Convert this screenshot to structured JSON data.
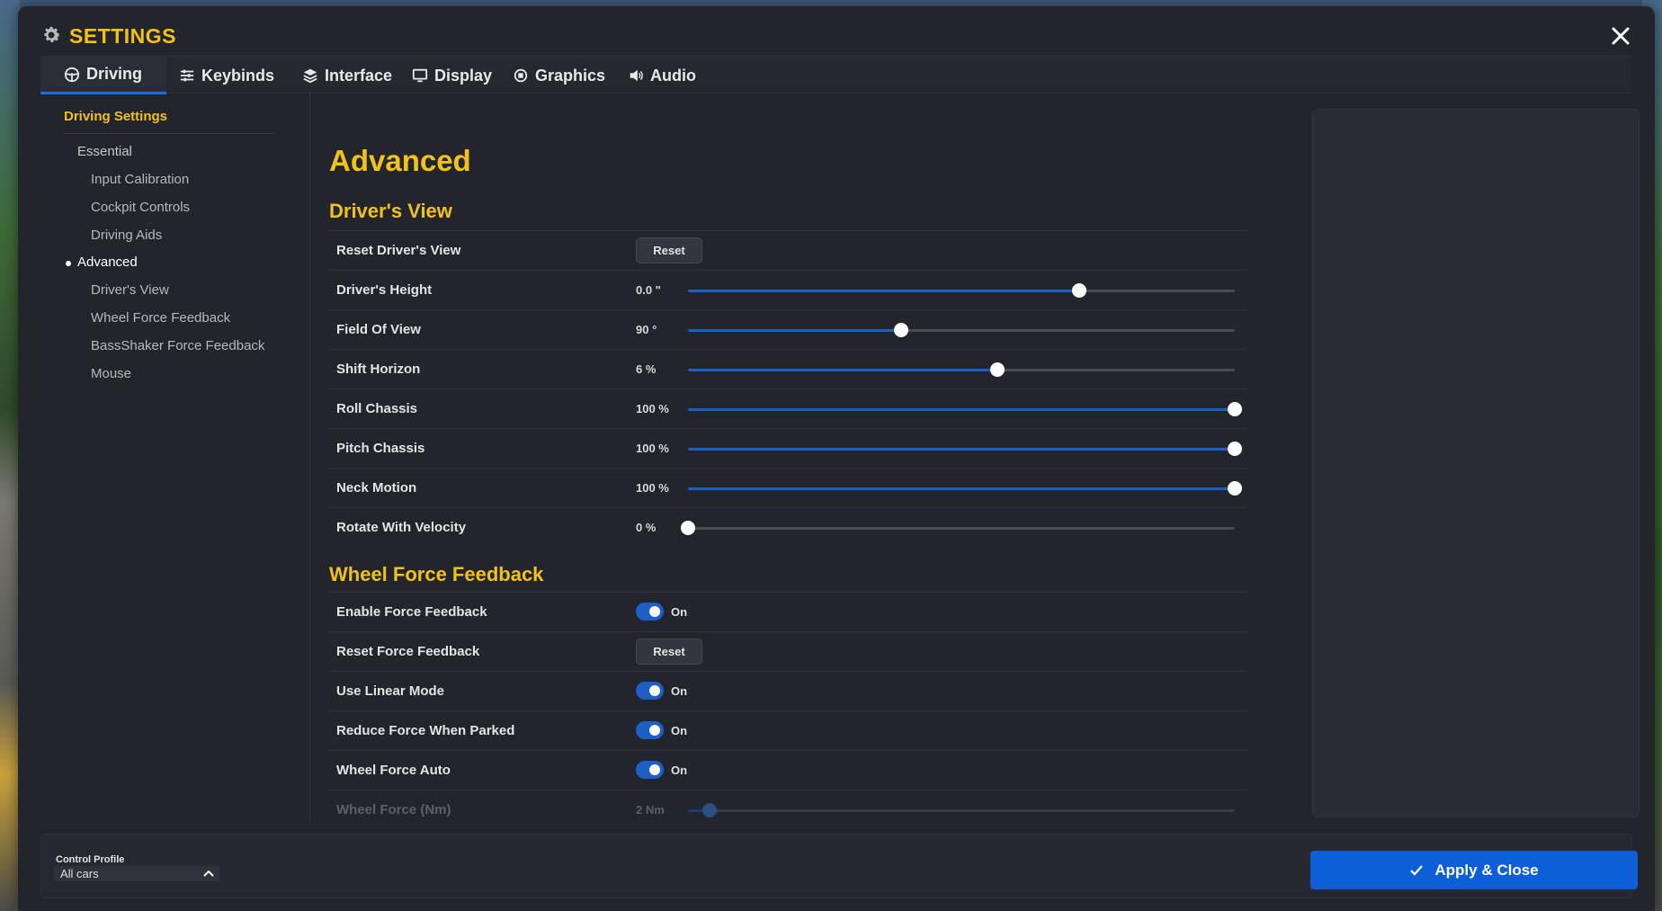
{
  "window": {
    "title": "SETTINGS"
  },
  "tabs": [
    {
      "label": "Driving",
      "icon": "steering-wheel-icon",
      "active": true
    },
    {
      "label": "Keybinds",
      "icon": "sliders-icon"
    },
    {
      "label": "Interface",
      "icon": "layers-icon"
    },
    {
      "label": "Display",
      "icon": "monitor-icon"
    },
    {
      "label": "Graphics",
      "icon": "chip-icon"
    },
    {
      "label": "Audio",
      "icon": "speaker-icon"
    }
  ],
  "nav": {
    "header": "Driving Settings",
    "items": [
      {
        "label": "Essential",
        "level": 1
      },
      {
        "label": "Input Calibration",
        "level": 2
      },
      {
        "label": "Cockpit Controls",
        "level": 2
      },
      {
        "label": "Driving Aids",
        "level": 2
      },
      {
        "label": "Advanced",
        "level": 1,
        "active": true
      },
      {
        "label": "Driver's View",
        "level": 2
      },
      {
        "label": "Wheel Force Feedback",
        "level": 2
      },
      {
        "label": "BassShaker Force Feedback",
        "level": 2
      },
      {
        "label": "Mouse",
        "level": 2
      }
    ]
  },
  "main": {
    "heading": "Advanced",
    "drivers_view": {
      "title": "Driver's View",
      "rows": [
        {
          "label": "Reset Driver's View",
          "type": "button",
          "button_label": "Reset"
        },
        {
          "label": "Driver's Height",
          "type": "slider",
          "value": "0.0 \"",
          "level": 0.715
        },
        {
          "label": "Field Of View",
          "type": "slider",
          "value": "90 °",
          "level": 0.39
        },
        {
          "label": "Shift Horizon",
          "type": "slider",
          "value": "6 %",
          "level": 0.565
        },
        {
          "label": "Roll Chassis",
          "type": "slider",
          "value": "100 %",
          "level": 1.0
        },
        {
          "label": "Pitch Chassis",
          "type": "slider",
          "value": "100 %",
          "level": 1.0
        },
        {
          "label": "Neck Motion",
          "type": "slider",
          "value": "100 %",
          "level": 1.0
        },
        {
          "label": "Rotate With Velocity",
          "type": "slider",
          "value": "0 %",
          "level": 0.0
        }
      ]
    },
    "wheel_ffb": {
      "title": "Wheel Force Feedback",
      "rows": [
        {
          "label": "Enable Force Feedback",
          "type": "toggle",
          "state": "On"
        },
        {
          "label": "Reset Force Feedback",
          "type": "button",
          "button_label": "Reset"
        },
        {
          "label": "Use Linear Mode",
          "type": "toggle",
          "state": "On"
        },
        {
          "label": "Reduce Force When Parked",
          "type": "toggle",
          "state": "On"
        },
        {
          "label": "Wheel Force Auto",
          "type": "toggle",
          "state": "On"
        },
        {
          "label": "Wheel Force (Nm)",
          "type": "slider",
          "value": "2 Nm",
          "level": 0.04,
          "disabled": true
        }
      ]
    }
  },
  "footer": {
    "profile_label": "Control Profile",
    "profile_value": "All cars",
    "apply_label": "Apply & Close"
  },
  "colors": {
    "accent_yellow": "#f2c21b",
    "accent_blue": "#1d5fc4",
    "apply_blue": "#0d5fd8",
    "panel_bg": "#23252c"
  }
}
